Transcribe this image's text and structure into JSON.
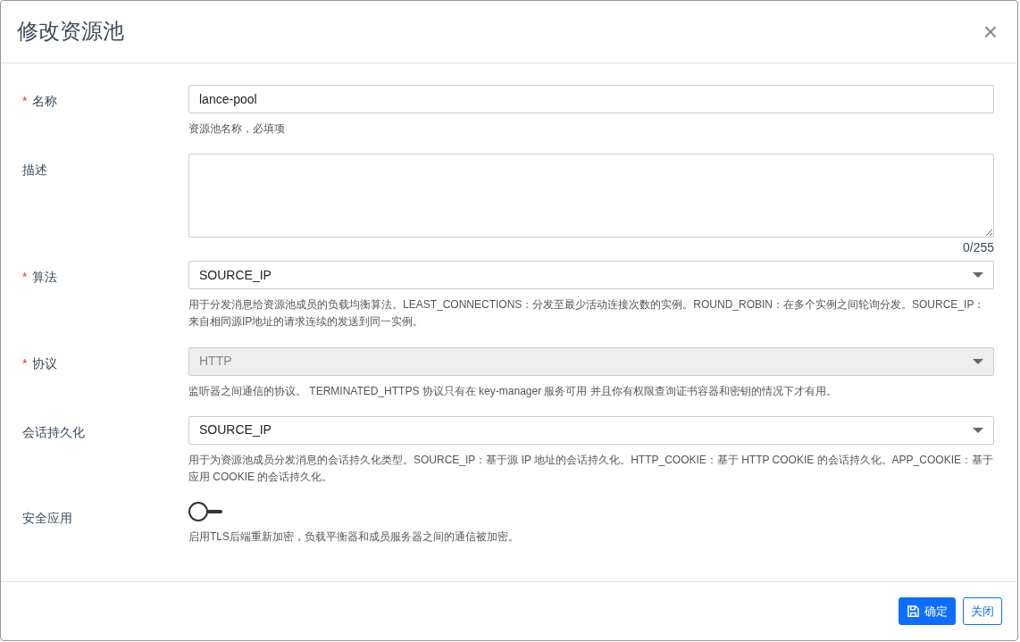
{
  "dialog": {
    "title": "修改资源池",
    "close_symbol": "×",
    "required_mark": "*"
  },
  "fields": [
    {
      "kind": "text",
      "label": "名称",
      "required": true,
      "value": "lance-pool",
      "help": "资源池名称，必填项"
    },
    {
      "kind": "textarea",
      "label": "描述",
      "required": false,
      "counter": "0/255"
    },
    {
      "kind": "select",
      "label": "算法",
      "required": true,
      "disabled": false,
      "value": "SOURCE_IP",
      "help": "用于分发消息给资源池成员的负载均衡算法。LEAST_CONNECTIONS：分发至最少活动连接次数的实例。ROUND_ROBIN：在多个实例之间轮询分发。SOURCE_IP：来自相同源IP地址的请求连续的发送到同一实例。"
    },
    {
      "kind": "select",
      "label": "协议",
      "required": true,
      "disabled": true,
      "value": "HTTP",
      "help": "监听器之间通信的协议。 TERMINATED_HTTPS 协议只有在 key-manager 服务可用 并且你有权限查询证书容器和密钥的情况下才有用。"
    },
    {
      "kind": "select",
      "label": "会话持久化",
      "required": false,
      "disabled": false,
      "value": "SOURCE_IP",
      "help": "用于为资源池成员分发消息的会话持久化类型。SOURCE_IP：基于源 IP 地址的会话持久化。HTTP_COOKIE：基于 HTTP COOKIE 的会话持久化。APP_COOKIE：基于应用 COOKIE 的会话持久化。"
    },
    {
      "kind": "switch",
      "label": "安全应用",
      "required": false,
      "on": false,
      "help": "启用TLS后端重新加密，负载平衡器和成员服务器之间的通信被加密。"
    }
  ],
  "buttons": [
    {
      "label": "确定",
      "kind": "primary"
    },
    {
      "label": "关闭",
      "kind": "secondary"
    }
  ]
}
